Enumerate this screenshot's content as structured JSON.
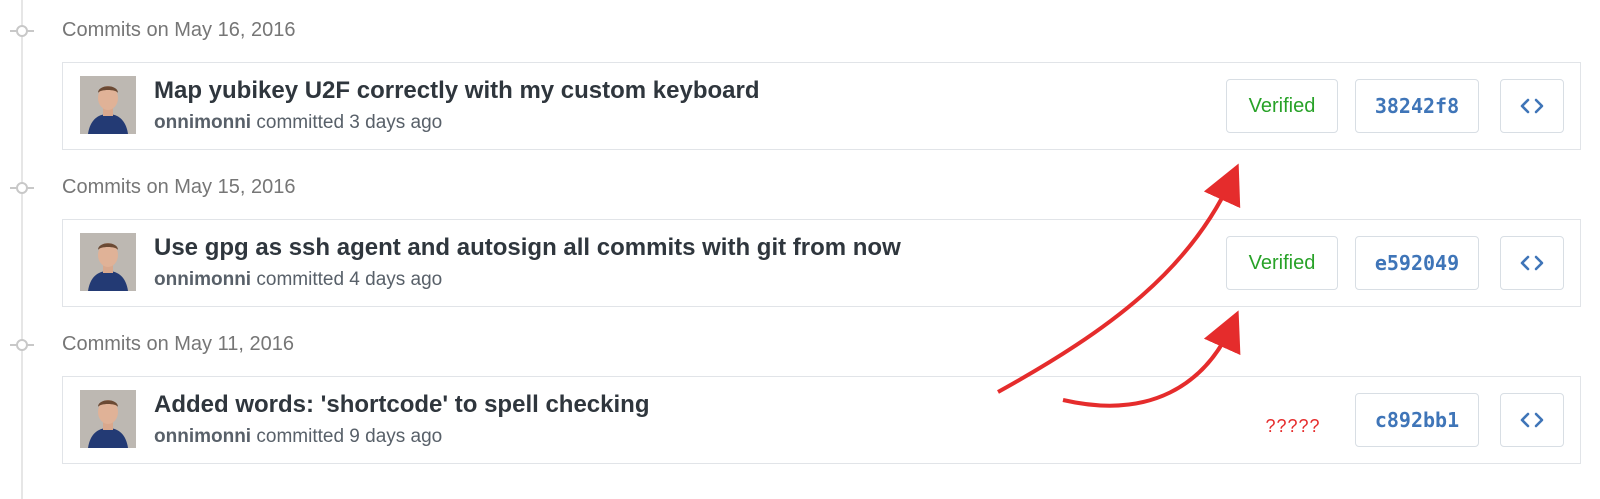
{
  "sections": [
    {
      "date_label": "Commits on May 16, 2016",
      "commit": {
        "message": "Map yubikey U2F correctly with my custom keyboard",
        "author": "onnimonni",
        "meta_text": "committed 3 days ago",
        "verified_label": "Verified",
        "sha": "38242f8"
      }
    },
    {
      "date_label": "Commits on May 15, 2016",
      "commit": {
        "message": "Use gpg as ssh agent and autosign all commits with git from now",
        "author": "onnimonni",
        "meta_text": "committed 4 days ago",
        "verified_label": "Verified",
        "sha": "e592049"
      }
    },
    {
      "date_label": "Commits on May 11, 2016",
      "commit": {
        "message": "Added words: 'shortcode' to spell checking",
        "author": "onnimonni",
        "meta_text": "committed 9 days ago",
        "annotation": "?????",
        "sha": "c892bb1"
      }
    }
  ],
  "icons": {
    "browse": "code-brackets-icon",
    "timeline": "commit-node-icon"
  },
  "colors": {
    "verified": "#28a228",
    "link": "#3f75b8",
    "annotation": "#e52c2c"
  }
}
